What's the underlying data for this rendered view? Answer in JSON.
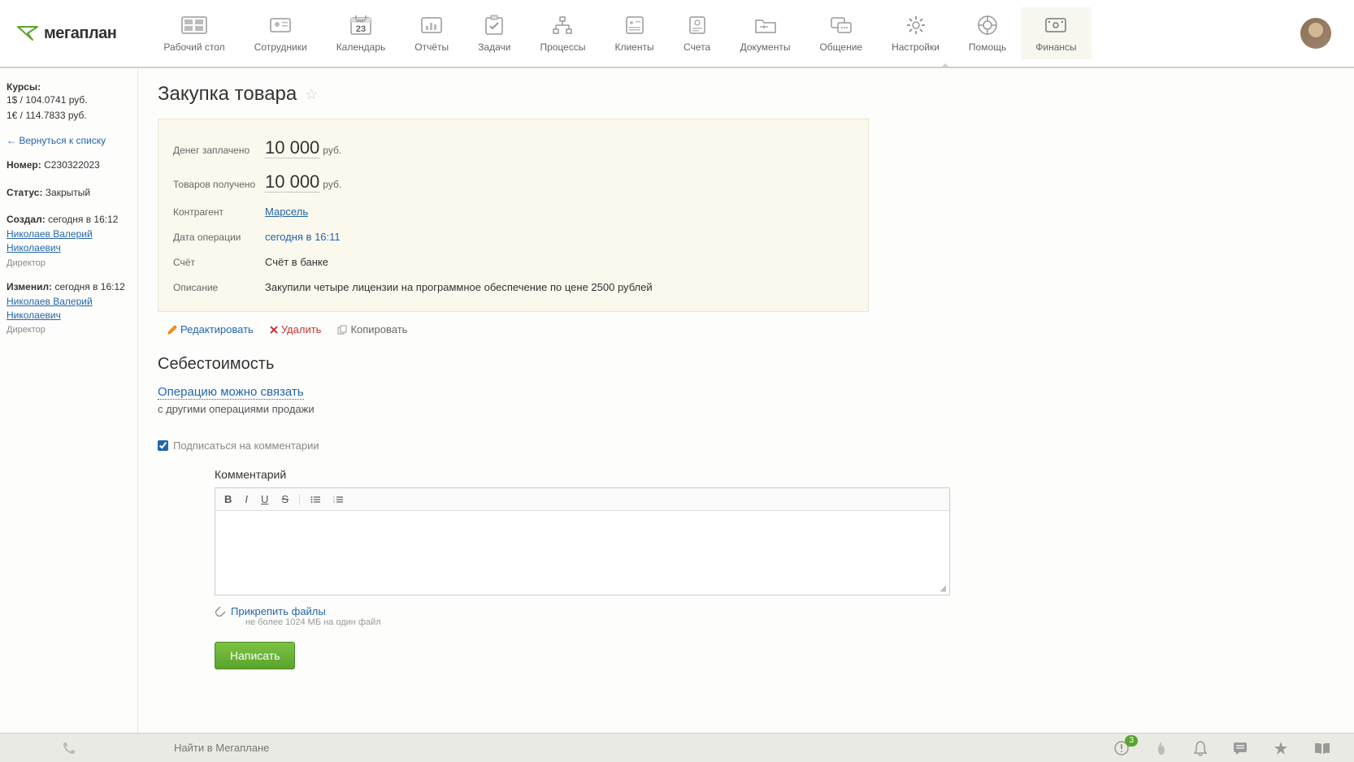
{
  "brand": "мегаплан",
  "nav": [
    {
      "label": "Рабочий стол"
    },
    {
      "label": "Сотрудники"
    },
    {
      "label": "Календарь",
      "day": "23",
      "month": "март"
    },
    {
      "label": "Отчёты"
    },
    {
      "label": "Задачи"
    },
    {
      "label": "Процессы"
    },
    {
      "label": "Клиенты"
    },
    {
      "label": "Счета"
    },
    {
      "label": "Документы"
    },
    {
      "label": "Общение"
    },
    {
      "label": "Настройки"
    },
    {
      "label": "Помощь"
    },
    {
      "label": "Финансы"
    }
  ],
  "sidebar": {
    "rates_title": "Курсы:",
    "rate_usd": "1$ / 104.0741 руб.",
    "rate_eur": "1€ / 114.7833 руб.",
    "back": "Вернуться к списку",
    "number_label": "Номер:",
    "number_value": "C230322023",
    "status_label": "Статус:",
    "status_value": "Закрытый",
    "created_label": "Создал:",
    "created_value": "сегодня в 16:12",
    "creator_name": "Николаев Валерий Николаевич",
    "creator_role": "Директор",
    "changed_label": "Изменил:",
    "changed_value": "сегодня в 16:12",
    "editor_name": "Николаев Валерий Николаевич",
    "editor_role": "Директор"
  },
  "page": {
    "title": "Закупка товара",
    "paid_label": "Денег заплачено",
    "paid_value": "10 000",
    "paid_unit": "руб.",
    "received_label": "Товаров получено",
    "received_value": "10 000",
    "received_unit": "руб.",
    "contragent_label": "Контрагент",
    "contragent_value": "Марсель",
    "op_date_label": "Дата операции",
    "op_date_value": "сегодня в 16:11",
    "account_label": "Счёт",
    "account_value": "Счёт в банке",
    "desc_label": "Описание",
    "desc_value": "Закупили четыре лицензии на программное обеспечение по цене 2500 рублей"
  },
  "actions": {
    "edit": "Редактировать",
    "delete": "Удалить",
    "copy": "Копировать"
  },
  "cost": {
    "title": "Себестоимость",
    "link": "Операцию можно связать",
    "subtext": "с другими операциями продажи"
  },
  "subscribe": {
    "label": "Подписаться на комментарии",
    "checked": true
  },
  "comment": {
    "label": "Комментарий",
    "attach": "Прикрепить файлы",
    "attach_note": "не более 1024 МБ на один файл",
    "submit": "Написать"
  },
  "bottombar": {
    "search_placeholder": "Найти в Мегаплане",
    "badge": "3"
  }
}
